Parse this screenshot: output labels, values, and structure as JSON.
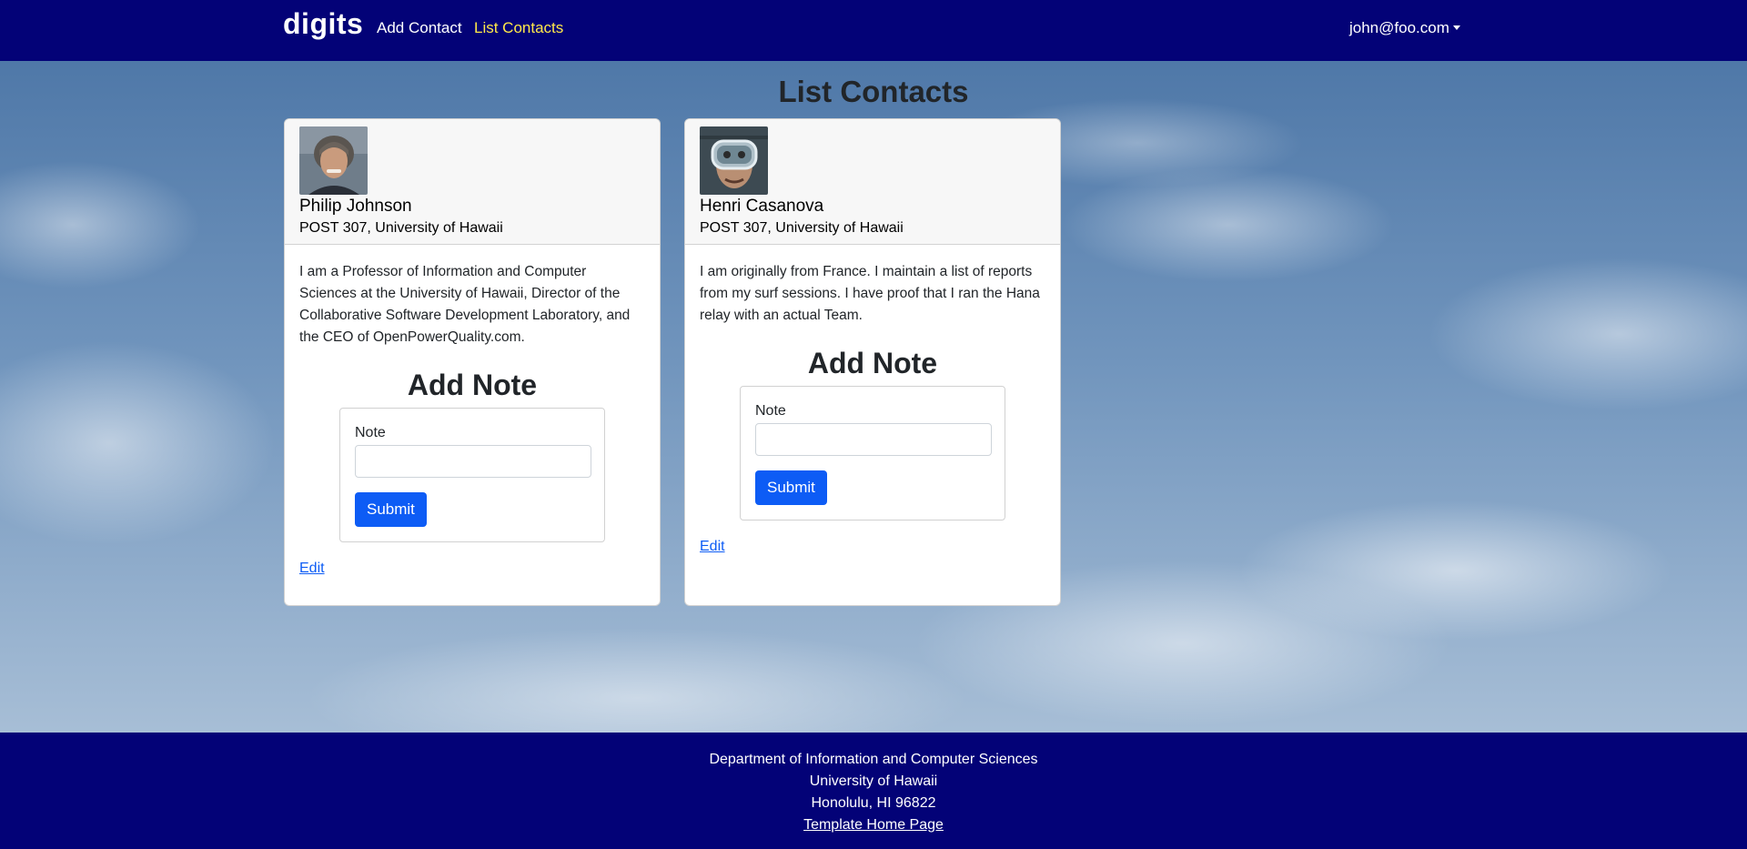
{
  "navbar": {
    "brand": "digits",
    "links": [
      {
        "label": "Add Contact",
        "active": false
      },
      {
        "label": "List Contacts",
        "active": true
      }
    ],
    "user": "john@foo.com",
    "background_color": "#030277",
    "active_link_color": "#ffe84a"
  },
  "main": {
    "title": "List Contacts",
    "contacts": [
      {
        "name": "Philip Johnson",
        "address": "POST 307, University of Hawaii",
        "description": "I am a Professor of Information and Computer Sciences at the University of Hawaii, Director of the Collaborative Software Development Laboratory, and the CEO of OpenPowerQuality.com.",
        "avatar_icon": "portrait-photo-man-gray-hair",
        "note_title": "Add Note",
        "note_label": "Note",
        "note_value": "",
        "submit_label": "Submit",
        "edit_label": "Edit"
      },
      {
        "name": "Henri Casanova",
        "address": "POST 307, University of Hawaii",
        "description": "I am originally from France. I maintain a list of reports from my surf sessions. I have proof that I ran the Hana relay with an actual Team.",
        "avatar_icon": "portrait-photo-man-diving-mask",
        "note_title": "Add Note",
        "note_label": "Note",
        "note_value": "",
        "submit_label": "Submit",
        "edit_label": "Edit"
      }
    ]
  },
  "footer": {
    "lines": [
      "Department of Information and Computer Sciences",
      "University of Hawaii",
      "Honolulu, HI 96822"
    ],
    "link_label": "Template Home Page"
  },
  "colors": {
    "primary_button": "#0d5cf5",
    "footer_background": "#030277"
  }
}
